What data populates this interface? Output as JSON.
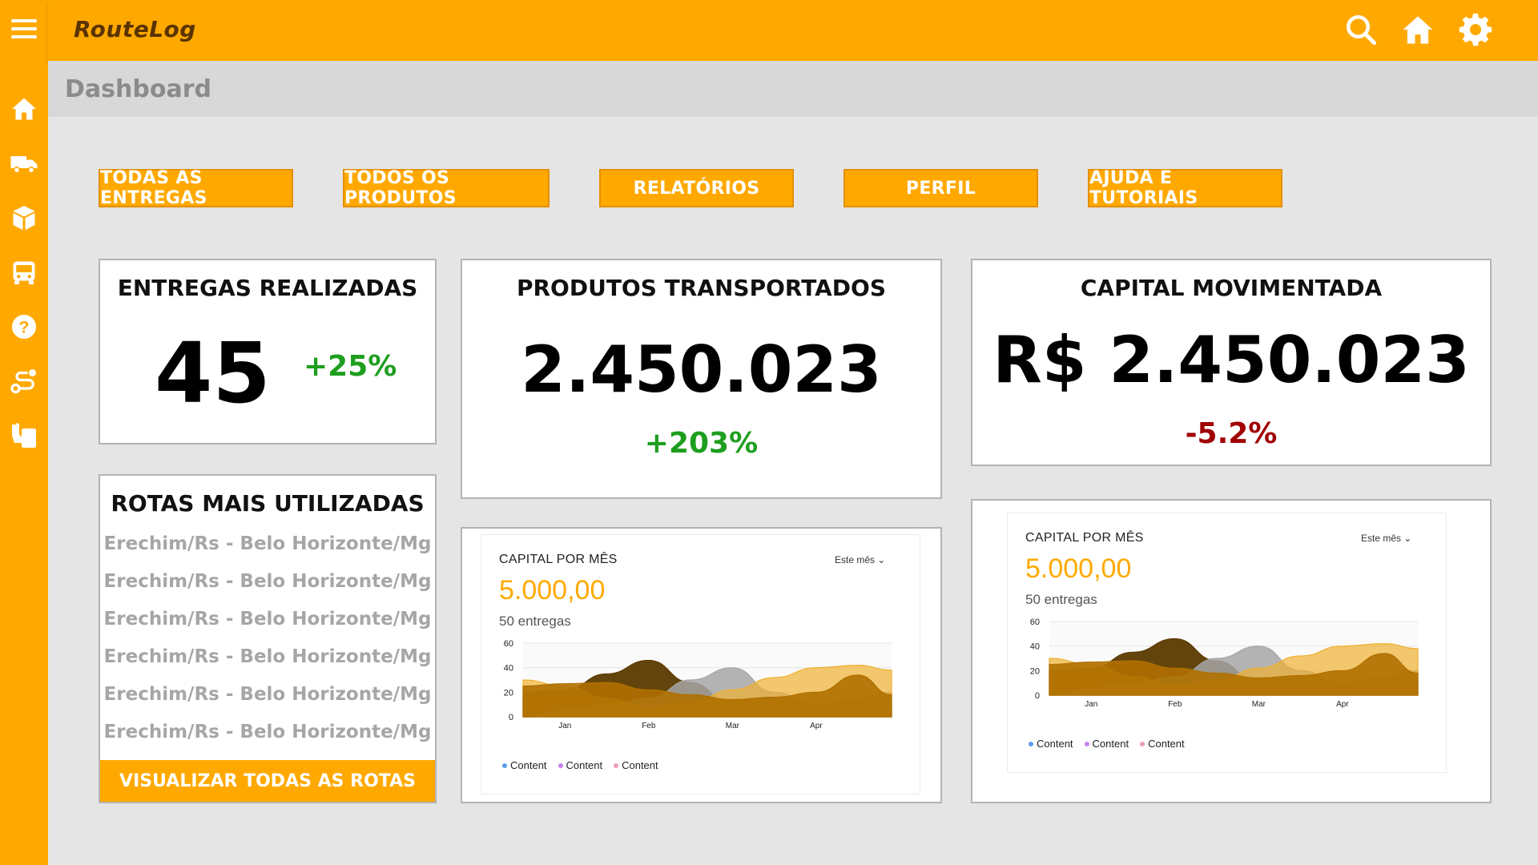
{
  "app": {
    "logo": "RouteLog"
  },
  "header": {
    "page_title": "Dashboard"
  },
  "sidebar": {
    "items": [
      {
        "name": "home"
      },
      {
        "name": "truck"
      },
      {
        "name": "box"
      },
      {
        "name": "bus"
      },
      {
        "name": "help"
      },
      {
        "name": "route"
      },
      {
        "name": "clipboard-hand"
      }
    ]
  },
  "nav": {
    "buttons": [
      "TODAS AS ENTREGAS",
      "TODOS OS PRODUTOS",
      "RELATÓRIOS",
      "PERFIL",
      "AJUDA E TUTORIAIS"
    ]
  },
  "stats": {
    "entregas": {
      "title": "ENTREGAS REALIZADAS",
      "value": "45",
      "change": "+25%"
    },
    "produtos": {
      "title": "PRODUTOS TRANSPORTADOS",
      "value": "2.450.023",
      "change": "+203%"
    },
    "capital": {
      "title": "CAPITAL MOVIMENTADA",
      "value": "R$ 2.450.023",
      "change": "-5.2%"
    }
  },
  "routes": {
    "title": "ROTAS MAIS UTILIZADAS",
    "items": [
      "Erechim/Rs - Belo Horizonte/Mg",
      "Erechim/Rs - Belo Horizonte/Mg",
      "Erechim/Rs - Belo Horizonte/Mg",
      "Erechim/Rs - Belo Horizonte/Mg",
      "Erechim/Rs - Belo Horizonte/Mg",
      "Erechim/Rs - Belo Horizonte/Mg"
    ],
    "button": "VISUALIZAR TODAS AS ROTAS"
  },
  "colors": {
    "brand": "#ffa900",
    "positive": "#1e9e1e",
    "negative": "#a10000",
    "series": [
      "#5c3a00",
      "#a6a6a6",
      "#f0b030",
      "#b07000"
    ],
    "legend_dots": [
      "#5b9cf0",
      "#c784f0",
      "#f09ac0"
    ]
  },
  "chart_widgets": [
    {
      "title": "CAPITAL POR MÊS",
      "select": "Este mês",
      "value": "5.000,00",
      "sub": "50 entregas",
      "legend": [
        "Content",
        "Content",
        "Content"
      ]
    },
    {
      "title": "CAPITAL POR MÊS",
      "select": "Este mês",
      "value": "5.000,00",
      "sub": "50 entregas",
      "legend": [
        "Content",
        "Content",
        "Content"
      ]
    }
  ],
  "chart_data": [
    {
      "type": "area",
      "categories": [
        "Jan",
        "Feb",
        "Mar",
        "Apr"
      ],
      "ylim": [
        0,
        60
      ],
      "yticks": [
        0,
        20,
        40,
        60
      ],
      "x": [
        0,
        0.5,
        1,
        1.5,
        2,
        2.5,
        3,
        3.5,
        4,
        4.4
      ],
      "series": [
        {
          "values": [
            20,
            22,
            35,
            46,
            28,
            10,
            8,
            10,
            12,
            12
          ]
        },
        {
          "values": [
            0,
            5,
            10,
            15,
            30,
            40,
            20,
            10,
            15,
            20
          ]
        },
        {
          "values": [
            30,
            25,
            15,
            8,
            12,
            22,
            32,
            40,
            42,
            38
          ]
        },
        {
          "values": [
            25,
            27,
            28,
            22,
            18,
            14,
            16,
            20,
            34,
            18
          ]
        }
      ],
      "legend": [
        "Content",
        "Content",
        "Content"
      ]
    },
    {
      "type": "area",
      "categories": [
        "Jan",
        "Feb",
        "Mar",
        "Apr"
      ],
      "ylim": [
        0,
        60
      ],
      "yticks": [
        0,
        20,
        40,
        60
      ],
      "x": [
        0,
        0.5,
        1,
        1.5,
        2,
        2.5,
        3,
        3.5,
        4,
        4.4
      ],
      "series": [
        {
          "values": [
            20,
            22,
            35,
            46,
            28,
            10,
            8,
            10,
            12,
            12
          ]
        },
        {
          "values": [
            0,
            5,
            10,
            15,
            30,
            40,
            20,
            10,
            15,
            20
          ]
        },
        {
          "values": [
            30,
            25,
            15,
            8,
            12,
            22,
            32,
            40,
            42,
            38
          ]
        },
        {
          "values": [
            25,
            27,
            28,
            22,
            18,
            14,
            16,
            20,
            34,
            18
          ]
        }
      ],
      "legend": [
        "Content",
        "Content",
        "Content"
      ]
    }
  ]
}
